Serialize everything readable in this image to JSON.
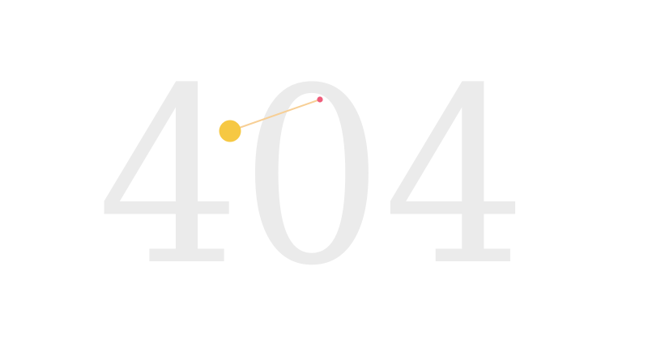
{
  "error_code": "404",
  "colors": {
    "background": "#ffffff",
    "digits": "#ebebeb",
    "ball": "#f6c843",
    "string": "#f7cf96",
    "pivot": "#ef5d7b"
  },
  "icons": {
    "pendulum_ball": "circle",
    "pendulum_pivot": "dot"
  }
}
